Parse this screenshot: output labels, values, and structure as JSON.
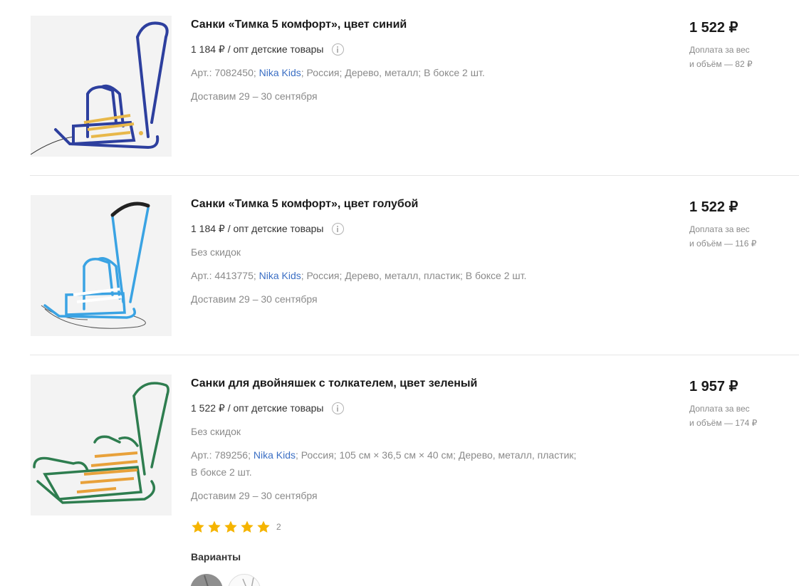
{
  "products": [
    {
      "title": "Санки «Тимка 5 комфорт», цвет синий",
      "opt_price": "1 184 ₽ / опт детские товары",
      "article": "Арт.: 7082450;",
      "brand": "Nika Kids",
      "attrs": [
        "; Россия;",
        "Дерево, металл;",
        "В боксе 2 шт."
      ],
      "delivery": "Доставим 29 – 30 сентября",
      "price": "1 522 ₽",
      "surcharge_line1": "Доплата за вес",
      "surcharge_line2": "и объём — 82 ₽",
      "color": "#2d3f9e"
    },
    {
      "title": "Санки «Тимка 5 комфорт», цвет голубой",
      "opt_price": "1 184 ₽ / опт детские товары",
      "discount": "Без скидок",
      "article": "Арт.: 4413775;",
      "brand": "Nika Kids",
      "attrs": [
        "; Россия;",
        "Дерево, металл, пластик;",
        "В боксе 2 шт."
      ],
      "delivery": "Доставим 29 – 30 сентября",
      "price": "1 522 ₽",
      "surcharge_line1": "Доплата за вес",
      "surcharge_line2": "и объём — 116 ₽",
      "color": "#3aa3e3"
    },
    {
      "title": "Санки для двойняшек с толкателем, цвет зеленый",
      "opt_price": "1 522 ₽ / опт детские товары",
      "discount": "Без скидок",
      "article": "Арт.: 789256;",
      "brand": "Nika Kids",
      "attrs_line1": "; Россия;  105 см × 36,5 см × 40 см;  Дерево, металл, пластик;",
      "attrs_line2": "В боксе 2 шт.",
      "delivery": "Доставим 29 – 30 сентября",
      "price": "1 957 ₽",
      "surcharge_line1": "Доплата за вес",
      "surcharge_line2": "и объём — 174 ₽",
      "rating": 5,
      "review_count": "2",
      "variants_label": "Варианты",
      "color": "#2e7d4f"
    }
  ],
  "colors": {
    "star": "#f5b400",
    "brand_link": "#3b6fc4",
    "muted": "#8a8a8a"
  },
  "icons": [
    "info-icon",
    "star-icon",
    "swatch"
  ]
}
